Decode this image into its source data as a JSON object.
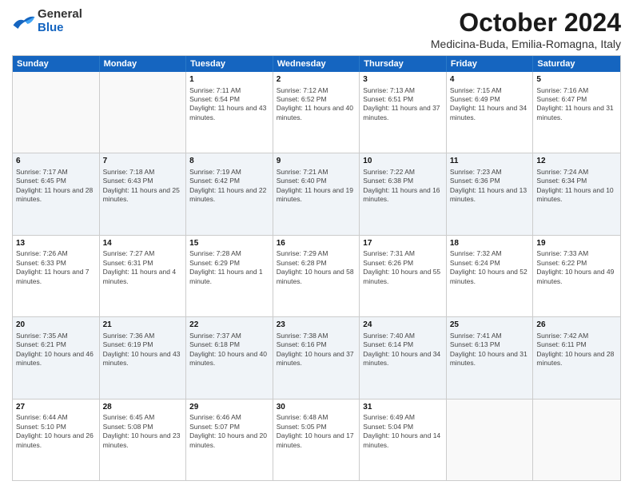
{
  "header": {
    "logo_general": "General",
    "logo_blue": "Blue",
    "month": "October 2024",
    "location": "Medicina-Buda, Emilia-Romagna, Italy"
  },
  "days_of_week": [
    "Sunday",
    "Monday",
    "Tuesday",
    "Wednesday",
    "Thursday",
    "Friday",
    "Saturday"
  ],
  "weeks": [
    [
      {
        "day": "",
        "info": ""
      },
      {
        "day": "",
        "info": ""
      },
      {
        "day": "1",
        "info": "Sunrise: 7:11 AM\nSunset: 6:54 PM\nDaylight: 11 hours and 43 minutes."
      },
      {
        "day": "2",
        "info": "Sunrise: 7:12 AM\nSunset: 6:52 PM\nDaylight: 11 hours and 40 minutes."
      },
      {
        "day": "3",
        "info": "Sunrise: 7:13 AM\nSunset: 6:51 PM\nDaylight: 11 hours and 37 minutes."
      },
      {
        "day": "4",
        "info": "Sunrise: 7:15 AM\nSunset: 6:49 PM\nDaylight: 11 hours and 34 minutes."
      },
      {
        "day": "5",
        "info": "Sunrise: 7:16 AM\nSunset: 6:47 PM\nDaylight: 11 hours and 31 minutes."
      }
    ],
    [
      {
        "day": "6",
        "info": "Sunrise: 7:17 AM\nSunset: 6:45 PM\nDaylight: 11 hours and 28 minutes."
      },
      {
        "day": "7",
        "info": "Sunrise: 7:18 AM\nSunset: 6:43 PM\nDaylight: 11 hours and 25 minutes."
      },
      {
        "day": "8",
        "info": "Sunrise: 7:19 AM\nSunset: 6:42 PM\nDaylight: 11 hours and 22 minutes."
      },
      {
        "day": "9",
        "info": "Sunrise: 7:21 AM\nSunset: 6:40 PM\nDaylight: 11 hours and 19 minutes."
      },
      {
        "day": "10",
        "info": "Sunrise: 7:22 AM\nSunset: 6:38 PM\nDaylight: 11 hours and 16 minutes."
      },
      {
        "day": "11",
        "info": "Sunrise: 7:23 AM\nSunset: 6:36 PM\nDaylight: 11 hours and 13 minutes."
      },
      {
        "day": "12",
        "info": "Sunrise: 7:24 AM\nSunset: 6:34 PM\nDaylight: 11 hours and 10 minutes."
      }
    ],
    [
      {
        "day": "13",
        "info": "Sunrise: 7:26 AM\nSunset: 6:33 PM\nDaylight: 11 hours and 7 minutes."
      },
      {
        "day": "14",
        "info": "Sunrise: 7:27 AM\nSunset: 6:31 PM\nDaylight: 11 hours and 4 minutes."
      },
      {
        "day": "15",
        "info": "Sunrise: 7:28 AM\nSunset: 6:29 PM\nDaylight: 11 hours and 1 minute."
      },
      {
        "day": "16",
        "info": "Sunrise: 7:29 AM\nSunset: 6:28 PM\nDaylight: 10 hours and 58 minutes."
      },
      {
        "day": "17",
        "info": "Sunrise: 7:31 AM\nSunset: 6:26 PM\nDaylight: 10 hours and 55 minutes."
      },
      {
        "day": "18",
        "info": "Sunrise: 7:32 AM\nSunset: 6:24 PM\nDaylight: 10 hours and 52 minutes."
      },
      {
        "day": "19",
        "info": "Sunrise: 7:33 AM\nSunset: 6:22 PM\nDaylight: 10 hours and 49 minutes."
      }
    ],
    [
      {
        "day": "20",
        "info": "Sunrise: 7:35 AM\nSunset: 6:21 PM\nDaylight: 10 hours and 46 minutes."
      },
      {
        "day": "21",
        "info": "Sunrise: 7:36 AM\nSunset: 6:19 PM\nDaylight: 10 hours and 43 minutes."
      },
      {
        "day": "22",
        "info": "Sunrise: 7:37 AM\nSunset: 6:18 PM\nDaylight: 10 hours and 40 minutes."
      },
      {
        "day": "23",
        "info": "Sunrise: 7:38 AM\nSunset: 6:16 PM\nDaylight: 10 hours and 37 minutes."
      },
      {
        "day": "24",
        "info": "Sunrise: 7:40 AM\nSunset: 6:14 PM\nDaylight: 10 hours and 34 minutes."
      },
      {
        "day": "25",
        "info": "Sunrise: 7:41 AM\nSunset: 6:13 PM\nDaylight: 10 hours and 31 minutes."
      },
      {
        "day": "26",
        "info": "Sunrise: 7:42 AM\nSunset: 6:11 PM\nDaylight: 10 hours and 28 minutes."
      }
    ],
    [
      {
        "day": "27",
        "info": "Sunrise: 6:44 AM\nSunset: 5:10 PM\nDaylight: 10 hours and 26 minutes."
      },
      {
        "day": "28",
        "info": "Sunrise: 6:45 AM\nSunset: 5:08 PM\nDaylight: 10 hours and 23 minutes."
      },
      {
        "day": "29",
        "info": "Sunrise: 6:46 AM\nSunset: 5:07 PM\nDaylight: 10 hours and 20 minutes."
      },
      {
        "day": "30",
        "info": "Sunrise: 6:48 AM\nSunset: 5:05 PM\nDaylight: 10 hours and 17 minutes."
      },
      {
        "day": "31",
        "info": "Sunrise: 6:49 AM\nSunset: 5:04 PM\nDaylight: 10 hours and 14 minutes."
      },
      {
        "day": "",
        "info": ""
      },
      {
        "day": "",
        "info": ""
      }
    ]
  ],
  "alt_rows": [
    1,
    3
  ]
}
